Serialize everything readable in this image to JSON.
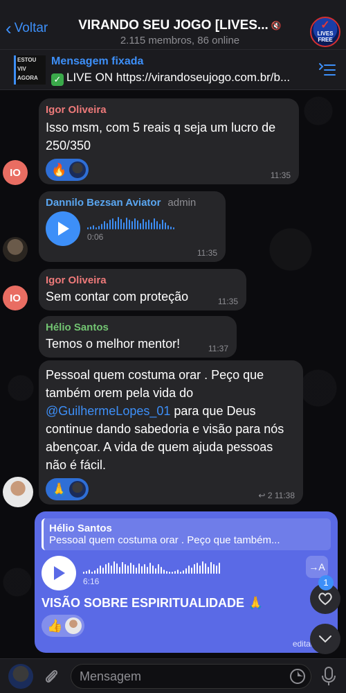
{
  "header": {
    "back_label": "Voltar",
    "title": "VIRANDO SEU JOGO [LIVES...",
    "subtitle": "2.115 membros, 86 online",
    "avatar_text": "LIVES FREE"
  },
  "pinned": {
    "label": "Mensagem fixada",
    "text": "LIVE ON https://virandoseujogo.com.br/b...",
    "thumb_text": "ESTOU VIV AGORA"
  },
  "messages": [
    {
      "sender": "Igor Oliveira",
      "sender_color": "#ee7a7a",
      "avatar_initials": "IO",
      "text": "Isso msm, com 5 reais q seja um lucro de 250/350",
      "reaction_emoji": "🔥",
      "time": "11:35"
    },
    {
      "sender": "Dannilo Bezsan Aviator",
      "sender_color": "#5aa6f0",
      "role": "admin",
      "voice_duration": "0:06",
      "time": "11:35"
    },
    {
      "sender": "Igor Oliveira",
      "sender_color": "#ee7a7a",
      "avatar_initials": "IO",
      "text": "Sem contar com proteção",
      "time": "11:35"
    },
    {
      "sender": "Hélio Santos",
      "sender_color": "#72c472",
      "text": "Temos o melhor mentor!",
      "time": "11:37"
    },
    {
      "text_before": "Pessoal quem costuma orar . Peço que também orem pela vida do ",
      "mention": "@GuilhermeLopes_01",
      "text_after": " para que Deus continue dando sabedoria e visão para nós abençoar.  A vida de quem ajuda pessoas não é fácil.",
      "reaction_emoji": "🙏",
      "reply_count": "2",
      "time": "11:38"
    }
  ],
  "outgoing": {
    "reply_name": "Hélio Santos",
    "reply_text": "Pessoal quem costuma orar . Peço que também...",
    "voice_duration": "6:16",
    "transcribe_label": "→A",
    "caption": "VISÃO SOBRE ESPIRITUALIDADE 🙏",
    "reaction_emoji": "👍",
    "edited_time": "editada 11:4"
  },
  "floating": {
    "reactions_badge": "1"
  },
  "input": {
    "placeholder": "Mensagem"
  },
  "colors": {
    "accent": "#3d8ff8",
    "outgoing_bubble": "#5a6ae6",
    "incoming_bubble": "#262629"
  }
}
